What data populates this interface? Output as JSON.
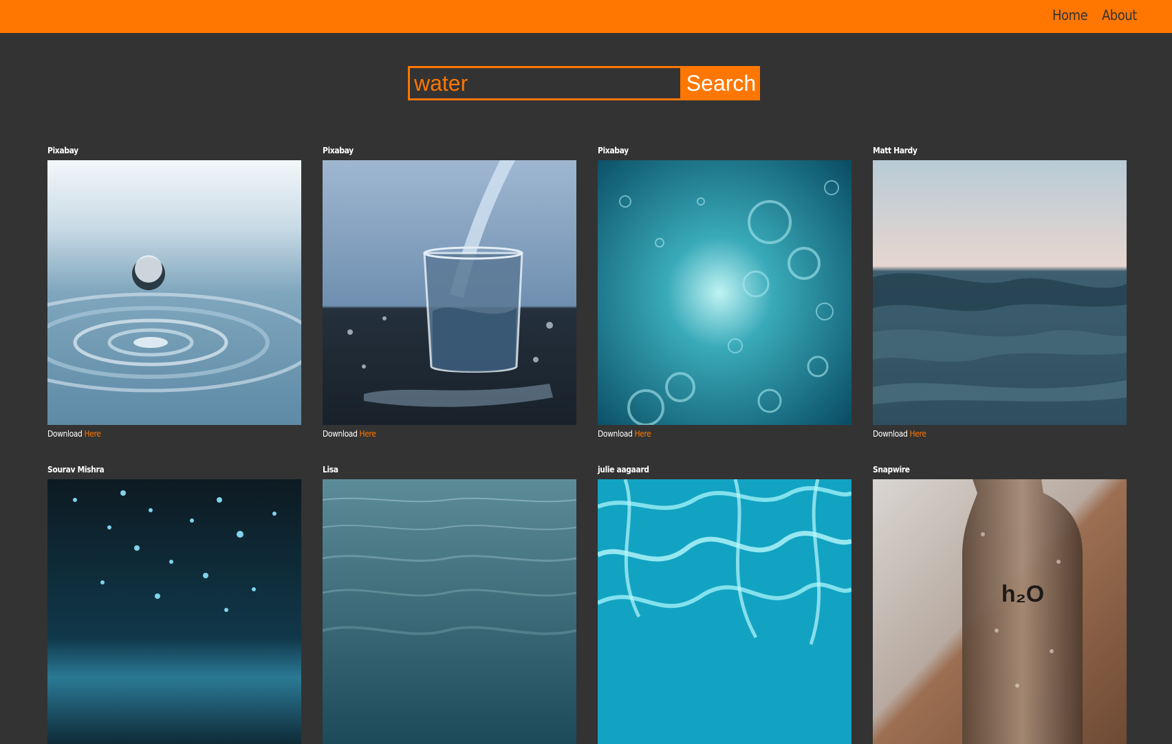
{
  "nav": {
    "home_label": "Home",
    "about_label": "About"
  },
  "search": {
    "value": "water",
    "button_label": "Search"
  },
  "download_prefix": "Download",
  "download_link_label": "Here",
  "photos": [
    {
      "author": "Pixabay",
      "image": "water-droplet-ripple-photo"
    },
    {
      "author": "Pixabay",
      "image": "water-pouring-into-glass-photo"
    },
    {
      "author": "Pixabay",
      "image": "underwater-bubbles-photo"
    },
    {
      "author": "Matt Hardy",
      "image": "ocean-wave-dusk-photo"
    },
    {
      "author": "Sourav Mishra",
      "image": "water-splash-droplets-photo"
    },
    {
      "author": "Lisa",
      "image": "sea-surface-photo"
    },
    {
      "author": "julie aagaard",
      "image": "pool-caustics-photo"
    },
    {
      "author": "Snapwire",
      "image": "h2o-bottle-photo"
    }
  ],
  "colors": {
    "accent": "#ff7700",
    "background": "#333333",
    "text": "#ffffff"
  }
}
